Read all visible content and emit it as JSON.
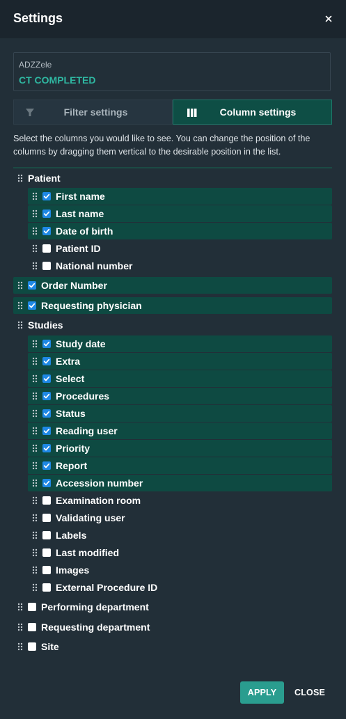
{
  "dialog": {
    "title": "Settings",
    "close_icon": "close-icon",
    "profile": {
      "name": "ADZZele",
      "status": "CT COMPLETED"
    },
    "tabs": [
      {
        "label": "Filter settings",
        "icon": "filter-icon",
        "active": false
      },
      {
        "label": "Column settings",
        "icon": "columns-icon",
        "active": true
      }
    ],
    "description": "Select the columns you would like to see. You can change the position of the columns by dragging them vertical to the desirable position in the list.",
    "columns": {
      "patient_group": {
        "label": "Patient",
        "items": [
          {
            "label": "First name",
            "checked": true
          },
          {
            "label": "Last name",
            "checked": true
          },
          {
            "label": "Date of birth",
            "checked": true
          },
          {
            "label": "Patient ID",
            "checked": false
          },
          {
            "label": "National number",
            "checked": false
          }
        ]
      },
      "order_number": {
        "label": "Order Number",
        "checked": true
      },
      "requesting_physician": {
        "label": "Requesting physician",
        "checked": true
      },
      "studies_group": {
        "label": "Studies",
        "items": [
          {
            "label": "Study date",
            "checked": true
          },
          {
            "label": "Extra",
            "checked": true
          },
          {
            "label": "Select",
            "checked": true
          },
          {
            "label": "Procedures",
            "checked": true
          },
          {
            "label": "Status",
            "checked": true
          },
          {
            "label": "Reading user",
            "checked": true
          },
          {
            "label": "Priority",
            "checked": true
          },
          {
            "label": "Report",
            "checked": true
          },
          {
            "label": "Accession number",
            "checked": true
          },
          {
            "label": "Examination room",
            "checked": false
          },
          {
            "label": "Validating user",
            "checked": false
          },
          {
            "label": "Labels",
            "checked": false
          },
          {
            "label": "Last modified",
            "checked": false
          },
          {
            "label": "Images",
            "checked": false
          },
          {
            "label": "External Procedure ID",
            "checked": false
          }
        ]
      },
      "performing_department": {
        "label": "Performing department",
        "checked": false
      },
      "requesting_department": {
        "label": "Requesting department",
        "checked": false
      },
      "site": {
        "label": "Site",
        "checked": false
      }
    },
    "footer": {
      "apply_label": "APPLY",
      "close_label": "CLOSE"
    },
    "colors": {
      "background": "#222f38",
      "header": "#1b252d",
      "accent": "#2a9d8f",
      "status_text": "#2fb8a2",
      "checked_row": "#0e4a42",
      "checkbox_on": "#1e88e5"
    }
  }
}
